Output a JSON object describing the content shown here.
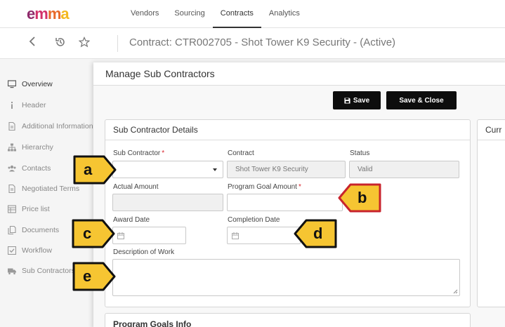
{
  "topnav": {
    "logo": {
      "e": "e",
      "m1": "m",
      "m2": "m",
      "a": "a"
    },
    "items": [
      "Vendors",
      "Sourcing",
      "Contracts",
      "Analytics"
    ]
  },
  "titlebar": {
    "title": "Contract: CTR002705 - Shot Tower K9 Security - (Active)"
  },
  "sidebar": {
    "items": [
      {
        "label": "Overview",
        "icon": "monitor-icon"
      },
      {
        "label": "Header",
        "icon": "info-icon"
      },
      {
        "label": "Additional Information",
        "icon": "document-icon"
      },
      {
        "label": "Hierarchy",
        "icon": "hierarchy-icon"
      },
      {
        "label": "Contacts",
        "icon": "contacts-icon"
      },
      {
        "label": "Negotiated Terms",
        "icon": "document-icon"
      },
      {
        "label": "Price list",
        "icon": "list-icon"
      },
      {
        "label": "Documents",
        "icon": "documents-icon"
      },
      {
        "label": "Workflow",
        "icon": "check-icon"
      },
      {
        "label": "Sub Contractors",
        "icon": "truck-icon"
      }
    ]
  },
  "modal": {
    "title": "Manage Sub Contractors",
    "save_label": "Save",
    "save_close_label": "Save & Close",
    "details_title": "Sub Contractor Details",
    "right_panel_title": "Curr",
    "goals_title": "Program Goals Info",
    "fields": {
      "sub_contractor": {
        "label": "Sub Contractor",
        "value": "",
        "required": "*"
      },
      "contract": {
        "label": "Contract",
        "value": "Shot Tower K9 Security"
      },
      "status": {
        "label": "Status",
        "value": "Valid"
      },
      "actual_amount": {
        "label": "Actual Amount",
        "value": ""
      },
      "program_goal_amount": {
        "label": "Program Goal Amount",
        "value": "",
        "required": "*"
      },
      "award_date": {
        "label": "Award Date",
        "value": ""
      },
      "completion_date": {
        "label": "Completion Date",
        "value": ""
      },
      "description": {
        "label": "Description of Work",
        "value": ""
      }
    }
  },
  "markers": {
    "a": "a",
    "b": "b",
    "c": "c",
    "d": "d",
    "e": "e"
  },
  "colors": {
    "marker_fill": "#f6c532",
    "marker_border": "#111111",
    "accent_red": "#d9262e",
    "button_bg": "#0d0d0d"
  }
}
